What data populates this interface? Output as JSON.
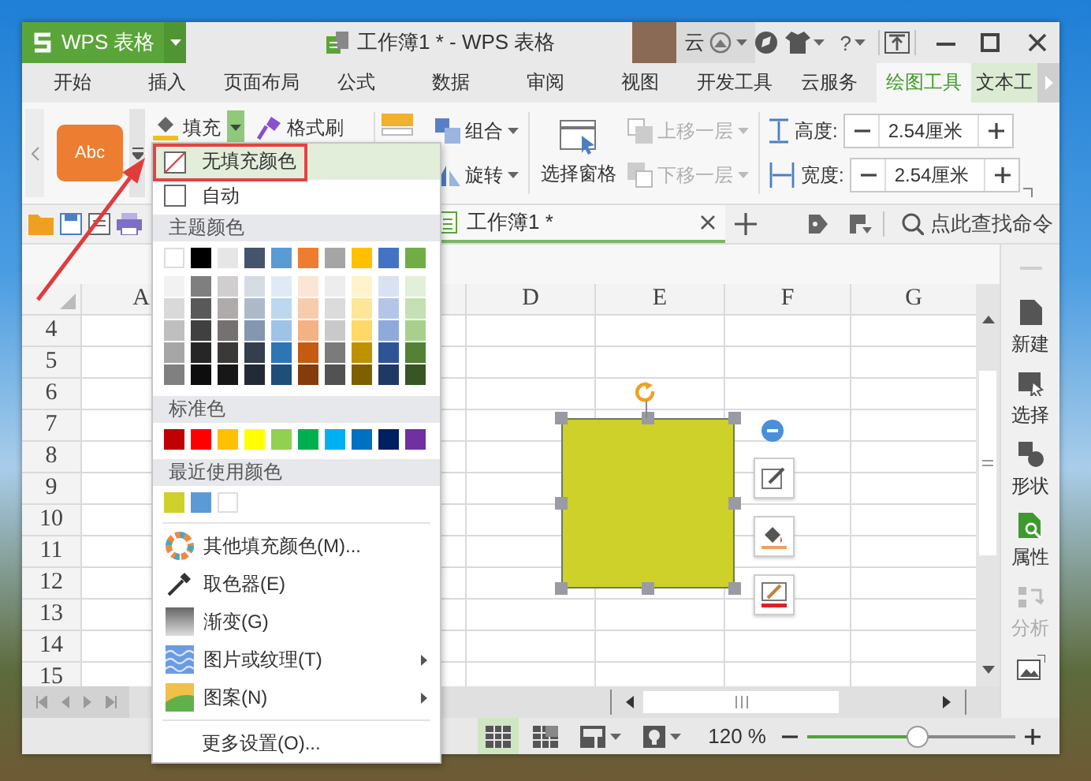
{
  "app_button": {
    "label": "WPS 表格"
  },
  "window": {
    "title": "工作簿1 * - WPS 表格"
  },
  "account": {
    "label": "云"
  },
  "help": {
    "label": "?"
  },
  "tabs": [
    {
      "label": "开始",
      "selected": false,
      "contextual": false
    },
    {
      "label": "插入",
      "selected": false,
      "contextual": false
    },
    {
      "label": "页面布局",
      "selected": false,
      "contextual": false
    },
    {
      "label": "公式",
      "selected": false,
      "contextual": false
    },
    {
      "label": "数据",
      "selected": false,
      "contextual": false
    },
    {
      "label": "审阅",
      "selected": false,
      "contextual": false
    },
    {
      "label": "视图",
      "selected": false,
      "contextual": false
    },
    {
      "label": "开发工具",
      "selected": false,
      "contextual": false
    },
    {
      "label": "云服务",
      "selected": false,
      "contextual": false
    },
    {
      "label": "绘图工具",
      "selected": true,
      "contextual": true
    },
    {
      "label": "文本工",
      "selected": false,
      "contextual": true
    }
  ],
  "ribbon": {
    "style_preview": "Abc",
    "fill": {
      "label": "填充",
      "open": true
    },
    "format_painter": "格式刷",
    "group": "组合",
    "rotate": "旋转",
    "selection_pane": "选择窗格",
    "bring_forward": {
      "label": "上移一层",
      "disabled": true
    },
    "send_backward": {
      "label": "下移一层",
      "disabled": true
    },
    "height": {
      "label": "高度:",
      "value": "2.54厘米"
    },
    "width": {
      "label": "宽度:",
      "value": "2.54厘米"
    }
  },
  "doc_tabs": [
    {
      "label": "工作簿1 *",
      "selected": true
    }
  ],
  "search": {
    "placeholder": "点此查找命令"
  },
  "sheet": {
    "columns": [
      "A",
      "D",
      "E",
      "F",
      "G"
    ],
    "rows": [
      "4",
      "5",
      "6",
      "7",
      "8",
      "9",
      "10",
      "11",
      "12",
      "13",
      "14",
      "15"
    ]
  },
  "side_panel": [
    {
      "label": "新建",
      "kind": "new",
      "selected": false,
      "disabled": false
    },
    {
      "label": "选择",
      "kind": "select",
      "selected": false,
      "disabled": false
    },
    {
      "label": "形状",
      "kind": "shape",
      "selected": false,
      "disabled": false
    },
    {
      "label": "属性",
      "kind": "properties",
      "selected": true,
      "disabled": false
    },
    {
      "label": "分析",
      "kind": "analyze",
      "selected": false,
      "disabled": true
    }
  ],
  "status_bar": {
    "views": [
      {
        "kind": "normal",
        "selected": true,
        "dropdown": false
      },
      {
        "kind": "page_break",
        "selected": false,
        "dropdown": false
      },
      {
        "kind": "page_layout",
        "selected": false,
        "dropdown": true
      },
      {
        "kind": "reading",
        "selected": false,
        "dropdown": true
      }
    ],
    "zoom": "120 %",
    "zoom_slider": {
      "level": 0.53
    }
  },
  "fill_menu": {
    "no_fill": {
      "label": "无填充颜色",
      "selected": true
    },
    "auto": {
      "label": "自动",
      "selected": false
    },
    "theme_header": "主题颜色",
    "theme_colors": [
      {
        "color": "#ffffff"
      },
      {
        "color": "#000000"
      },
      {
        "color": "#e7e6e6"
      },
      {
        "color": "#44546a"
      },
      {
        "color": "#5b9bd5"
      },
      {
        "color": "#ed7d31"
      },
      {
        "color": "#a5a5a5"
      },
      {
        "color": "#ffc000"
      },
      {
        "color": "#4472c4"
      },
      {
        "color": "#70ad47"
      }
    ],
    "theme_shades": [
      {
        "color": "#f2f2f2"
      },
      {
        "color": "#7f7f7f"
      },
      {
        "color": "#d0cece"
      },
      {
        "color": "#d6dce4"
      },
      {
        "color": "#deebf6"
      },
      {
        "color": "#fbe5d5"
      },
      {
        "color": "#ededed"
      },
      {
        "color": "#fff2cc"
      },
      {
        "color": "#d9e2f3"
      },
      {
        "color": "#e2efd9"
      },
      {
        "color": "#d9d9d9"
      },
      {
        "color": "#595959"
      },
      {
        "color": "#afabab"
      },
      {
        "color": "#adb9ca"
      },
      {
        "color": "#bdd7ee"
      },
      {
        "color": "#f7cbac"
      },
      {
        "color": "#dbdbdb"
      },
      {
        "color": "#fee599"
      },
      {
        "color": "#b4c6e7"
      },
      {
        "color": "#c5e0b3"
      },
      {
        "color": "#bfbfbf"
      },
      {
        "color": "#404040"
      },
      {
        "color": "#767171"
      },
      {
        "color": "#8497b0"
      },
      {
        "color": "#9dc3e6"
      },
      {
        "color": "#f4b183"
      },
      {
        "color": "#c9c9c9"
      },
      {
        "color": "#ffd966"
      },
      {
        "color": "#8eaadb"
      },
      {
        "color": "#a8d08d"
      },
      {
        "color": "#a6a6a6"
      },
      {
        "color": "#262626"
      },
      {
        "color": "#3b3838"
      },
      {
        "color": "#333f4f"
      },
      {
        "color": "#2e75b5"
      },
      {
        "color": "#c55a11"
      },
      {
        "color": "#7b7b7b"
      },
      {
        "color": "#bf9000"
      },
      {
        "color": "#2f5496"
      },
      {
        "color": "#538135"
      },
      {
        "color": "#808080"
      },
      {
        "color": "#0d0d0d"
      },
      {
        "color": "#181717"
      },
      {
        "color": "#222a35"
      },
      {
        "color": "#1f4e79"
      },
      {
        "color": "#843c0b"
      },
      {
        "color": "#525252"
      },
      {
        "color": "#7f6000"
      },
      {
        "color": "#1f3864"
      },
      {
        "color": "#375623"
      }
    ],
    "standard_header": "标准色",
    "standard_colors": [
      {
        "color": "#c00000"
      },
      {
        "color": "#ff0000"
      },
      {
        "color": "#ffc000"
      },
      {
        "color": "#ffff00"
      },
      {
        "color": "#92d050"
      },
      {
        "color": "#00b050"
      },
      {
        "color": "#00b0f0"
      },
      {
        "color": "#0070c0"
      },
      {
        "color": "#002060"
      },
      {
        "color": "#7030a0"
      }
    ],
    "recent_header": "最近使用颜色",
    "recent_colors": [
      {
        "color": "#cdd12a"
      },
      {
        "color": "#5b9bd5"
      },
      {
        "color": "#ffffff"
      }
    ],
    "actions": [
      {
        "label": "其他填充颜色(M)...",
        "kind": "palette",
        "submenu": false
      },
      {
        "label": "取色器(E)",
        "kind": "eyedropper",
        "submenu": false
      },
      {
        "label": "渐变(G)",
        "kind": "gradient",
        "submenu": false
      },
      {
        "label": "图片或纹理(T)",
        "kind": "texture",
        "submenu": true
      },
      {
        "label": "图案(N)",
        "kind": "pattern",
        "submenu": true
      }
    ],
    "more": "更多设置(O)..."
  }
}
